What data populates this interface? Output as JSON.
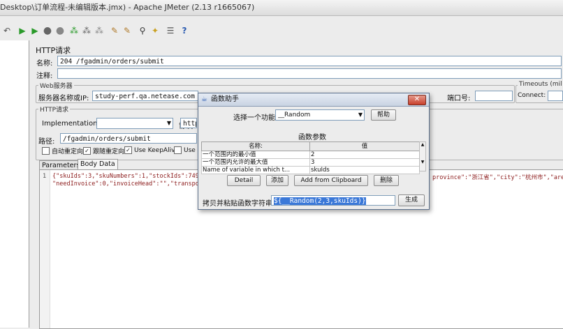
{
  "window": {
    "title": "Desktop\\订单流程-未编辑版本.jmx) - Apache JMeter (2.13 r1665067)"
  },
  "toolbar": {
    "icons": [
      "undo-icon",
      "start-icon",
      "start-no-pause-icon",
      "stop-icon",
      "shutdown-icon",
      "remote-start-icon",
      "remote-stop-icon",
      "remote-shutdown-icon",
      "clear-icon",
      "clear-all-icon",
      "search-icon",
      "reset-search-icon",
      "function-helper-icon",
      "help-icon"
    ]
  },
  "sampler": {
    "heading": "HTTP请求",
    "name_label": "名称:",
    "name_value": "204 /fgadmin/orders/submit",
    "comment_label": "注释:",
    "web_server_group": "Web服务器",
    "server_label": "服务器名称或IP:",
    "server_value": "study-perf.qa.netease.com",
    "port_label": "端口号:",
    "timeouts_group": "Timeouts (mil",
    "connect_label": "Connect:",
    "http_group": "HTTP请求",
    "implementation_label": "Implementation:",
    "protocol_label": "协议:",
    "protocol_value": "http",
    "path_label": "路径:",
    "path_value": "/fgadmin/orders/submit",
    "checkboxes": [
      {
        "label": "自动重定向",
        "checked": false
      },
      {
        "label": "跟随重定向",
        "checked": true
      },
      {
        "label": "Use KeepAlive",
        "checked": true
      },
      {
        "label": "Use m",
        "checked": false
      }
    ],
    "tabs": [
      "Parameters",
      "Body Data"
    ],
    "body": {
      "line_number": "1",
      "line1_part1": "{\"skuIds\":3,\"skuNumbers\":1,\"stockIds\":74966313,",
      "line1_part2": "province\":\"浙江省\",\"city\":\"杭州市\",\"area\":\"滨",
      "line2": "\"needInvoice\":0,\"invoiceHead\":\"\",\"transportFee\""
    }
  },
  "dialog": {
    "title": "函数助手",
    "close_label": "✕",
    "choose_label": "选择一个功能",
    "function_selected": "__Random",
    "help_button": "帮助",
    "params_title": "函数参数",
    "columns": [
      "名称:",
      "值"
    ],
    "rows": [
      {
        "name": "一个范围内的最小值",
        "value": "2"
      },
      {
        "name": "一个范围内允许的最大值",
        "value": "3"
      },
      {
        "name": "Name of variable in which t...",
        "value": "skuIds"
      }
    ],
    "buttons": [
      "Detail",
      "添加",
      "Add from Clipboard",
      "删除"
    ],
    "copy_label": "拷贝并粘贴函数字符串",
    "function_string": "${__Random(2,3,skuIds)}",
    "generate_button": "生成"
  }
}
